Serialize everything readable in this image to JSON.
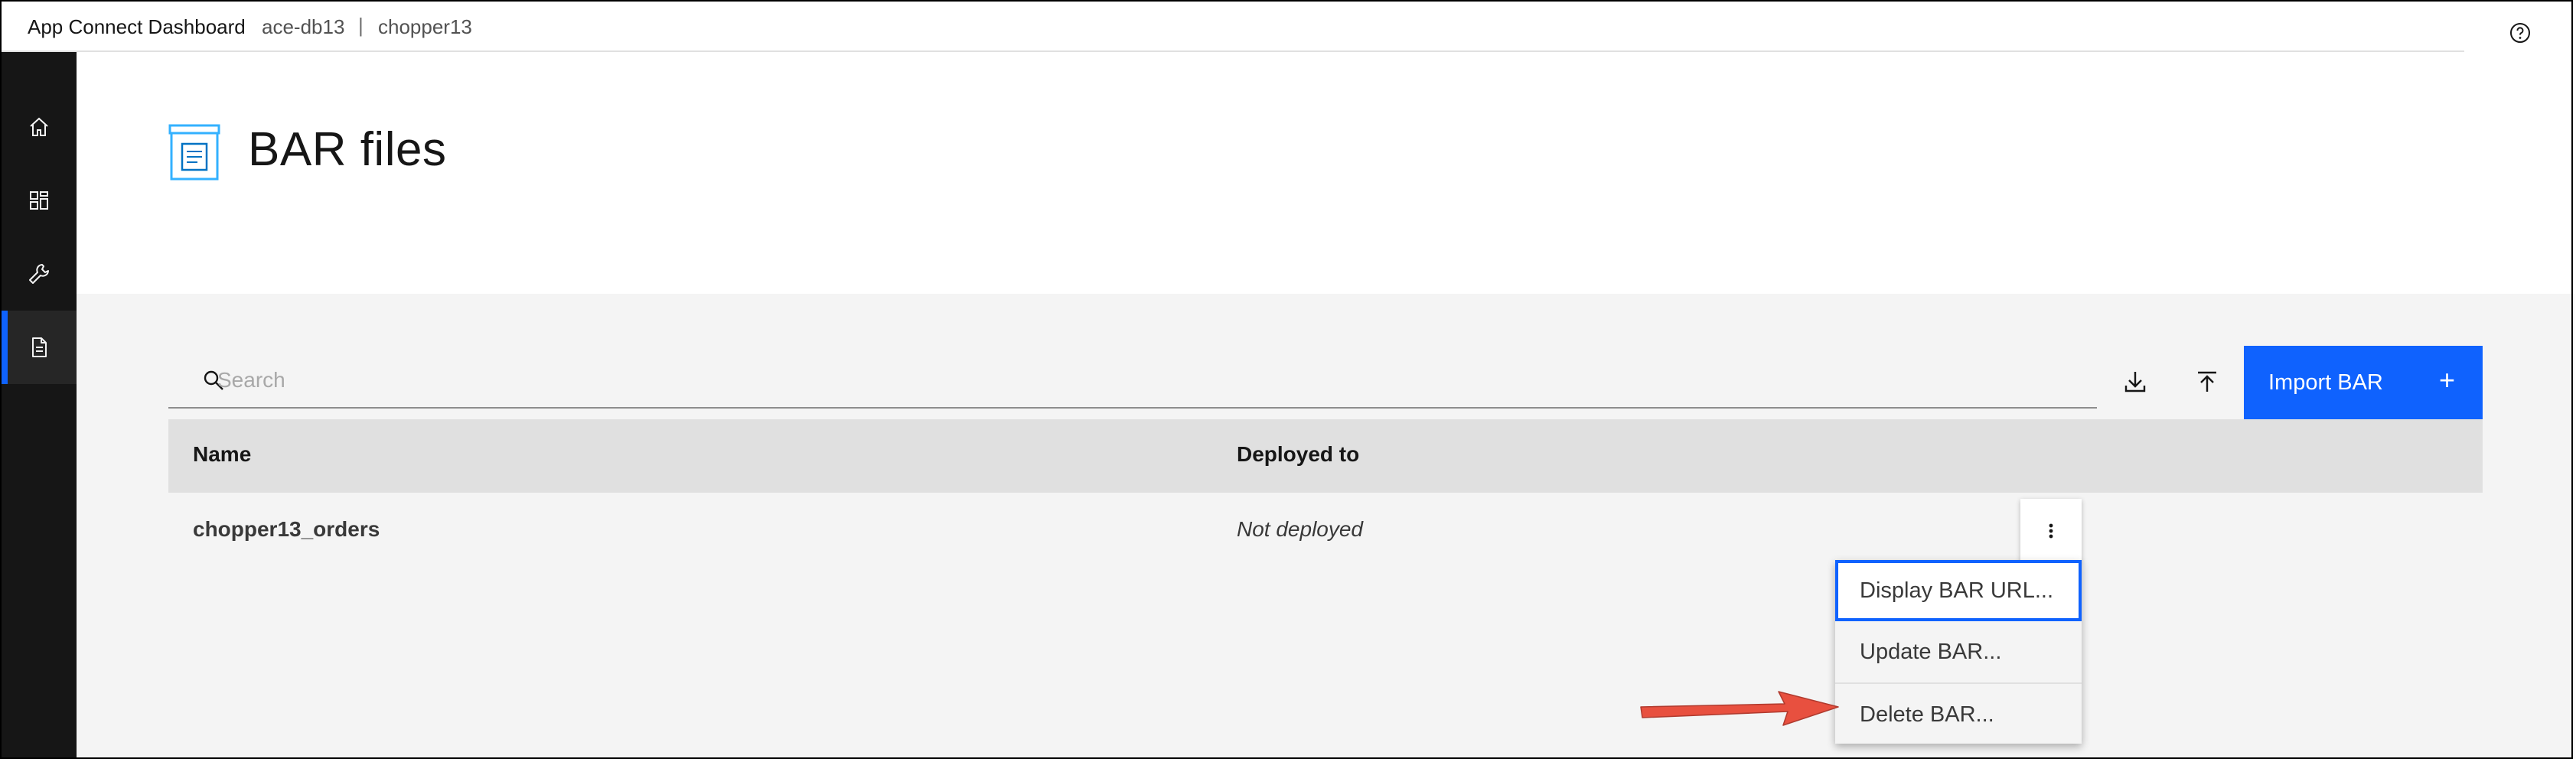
{
  "header": {
    "app_title": "App Connect Dashboard",
    "crumbs": [
      "ace-db13",
      "chopper13"
    ],
    "separator": "|",
    "help_icon": "help-icon"
  },
  "sidebar": {
    "items": [
      {
        "name": "home",
        "icon": "home-icon",
        "active": false
      },
      {
        "name": "dashboard",
        "icon": "dashboard-icon",
        "active": false
      },
      {
        "name": "tools",
        "icon": "wrench-icon",
        "active": false
      },
      {
        "name": "bar-files",
        "icon": "document-icon",
        "active": true
      }
    ]
  },
  "page": {
    "title": "BAR files",
    "icon": "bar-files-icon"
  },
  "toolbar": {
    "search_placeholder": "Search",
    "search_value": "",
    "download_icon": "download-icon",
    "upload_icon": "upload-icon",
    "import_label": "Import BAR",
    "import_plus": "+"
  },
  "table": {
    "columns": [
      "Name",
      "Deployed to"
    ],
    "rows": [
      {
        "name": "chopper13_orders",
        "deployed_to": "Not deployed"
      }
    ]
  },
  "overflow_menu": {
    "items": [
      "Display BAR URL...",
      "Update BAR...",
      "Delete BAR..."
    ],
    "focused_index": 0
  },
  "colors": {
    "accent": "#0f62fe",
    "sidebar_bg": "#161616",
    "content_bg": "#f4f4f4",
    "table_header_bg": "#e0e0e0",
    "annotation_arrow": "#e8503f"
  }
}
